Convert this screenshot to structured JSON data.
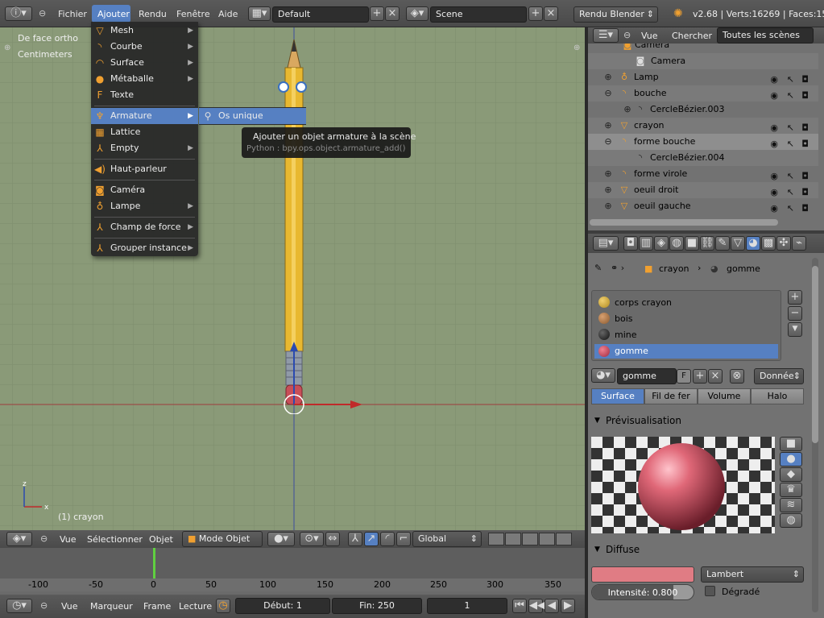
{
  "topbar": {
    "menus": [
      "Fichier",
      "Ajouter",
      "Rendu",
      "Fenêtre",
      "Aide"
    ],
    "layout": "Default",
    "scene": "Scene",
    "engine": "Rendu Blender",
    "stats": "v2.68 | Verts:16269 | Faces:15"
  },
  "viewport": {
    "view_name": "De face ortho",
    "units": "Centimeters",
    "object_label": "(1) crayon"
  },
  "ajouter_menu": {
    "items": [
      "Mesh",
      "Courbe",
      "Surface",
      "Métaballe",
      "Texte",
      "Armature",
      "Lattice",
      "Empty",
      "Haut-parleur",
      "Caméra",
      "Lampe",
      "Champ de force",
      "Grouper instance"
    ],
    "submenu_item": "Os unique"
  },
  "tooltip": {
    "title": "Ajouter un objet armature à la scène",
    "python": "Python   : bpy.ops.object.armature_add()"
  },
  "outliner": {
    "header": {
      "view": "Vue",
      "search": "Chercher",
      "filter": "Toutes les scènes"
    },
    "rows": [
      "Camera",
      "Camera",
      "Lamp",
      "bouche",
      "CercleBézier.003",
      "crayon",
      "forme bouche",
      "CercleBézier.004",
      "forme virole",
      "oeuil droit",
      "oeuil gauche"
    ]
  },
  "properties": {
    "breadcrumb": {
      "object": "crayon",
      "material": "gomme"
    },
    "materials": [
      "corps crayon",
      "bois",
      "mine",
      "gomme"
    ],
    "material_name": "gomme",
    "fake_user": "F",
    "data_link": "Donnée",
    "tabs": [
      "Surface",
      "Fil de fer",
      "Volume",
      "Halo"
    ],
    "preview_header": "Prévisualisation",
    "diffuse_header": "Diffuse",
    "diffuse_shader": "Lambert",
    "intensity_label": "Intensité: 0.800",
    "intensity": 0.8,
    "ramp_label": "Dégradé",
    "diffuse_color": "#e07c84"
  },
  "viewport_header": {
    "view": "Vue",
    "select": "Sélectionner",
    "object": "Objet",
    "mode": "Mode Objet",
    "orientation": "Global"
  },
  "timeline": {
    "ticks": [
      "-100",
      "-50",
      "0",
      "50",
      "100",
      "150",
      "200",
      "250",
      "300",
      "350"
    ],
    "view": "Vue",
    "marker": "Marqueur",
    "frame": "Frame",
    "playback": "Lecture",
    "start": "Début: 1",
    "end": "Fin: 250",
    "current": "1"
  },
  "colors": {
    "accent": "#5680c2",
    "viewport_bg": "#8a9a78",
    "pencil": "#e8b830"
  }
}
